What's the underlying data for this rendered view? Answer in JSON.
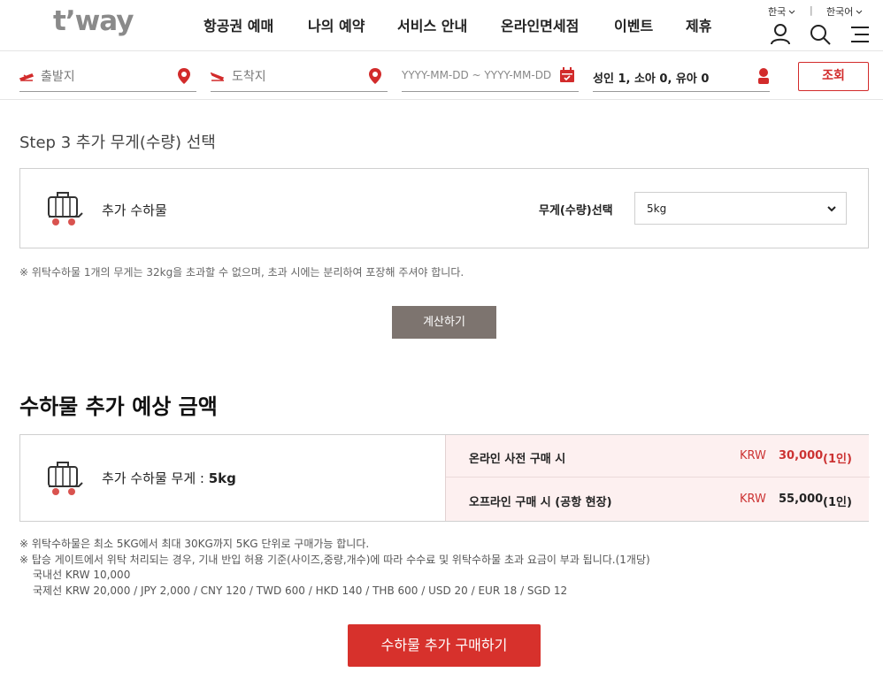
{
  "header": {
    "logo": "t’way",
    "nav": [
      "항공권 예매",
      "나의 예약",
      "서비스 안내",
      "온라인면세점",
      "이벤트",
      "제휴"
    ],
    "country": "한국",
    "separator": "|",
    "language": "한국어"
  },
  "search": {
    "departure_placeholder": "출발지",
    "arrival_placeholder": "도착지",
    "date_placeholder": "YYYY-MM-DD  ~ YYYY-MM-DD",
    "passengers": "성인 1, 소아 0, 유아 0",
    "submit_label": "조회"
  },
  "step": {
    "title": "Step 3 추가 무게(수량) 선택",
    "item_label": "추가 수하물",
    "select_label": "무게(수량)선택",
    "select_value": "5kg",
    "note": "※ 위탁수하물 1개의 무게는 32kg을 초과할 수 없으며, 초과 시에는 분리하여 포장해 주셔야 합니다.",
    "calc_button": "계산하기"
  },
  "estimate": {
    "title": "수하물 추가 예상 금액",
    "weight_label": "추가 수하물 무게 : ",
    "weight_value": "5kg",
    "rows": [
      {
        "label": "온라인 사전 구매 시",
        "currency": "KRW",
        "amount": "30,000",
        "per": "(1인)"
      },
      {
        "label": "오프라인 구매 시 (공항 현장)",
        "currency": "KRW",
        "amount": "55,000",
        "per": "(1인)"
      }
    ],
    "notes": [
      "※ 위탁수하물은 최소 5KG에서 최대 30KG까지 5KG 단위로 구매가능 합니다.",
      "※ 탑승 게이트에서 위탁 처리되는 경우, 기내 반입 허용 기준(사이즈,중량,개수)에 따라 수수료 및 위탁수하물 초과 요금이 부과 됩니다.(1개당)",
      "국내선 KRW 10,000",
      "국제선 KRW 20,000 / JPY 2,000 / CNY 120 / TWD 600 / HKD 140 / THB 600 / USD 20 / EUR 18 / SGD 12"
    ],
    "buy_button": "수하물 추가 구매하기"
  },
  "colors": {
    "brand_red": "#d7312c",
    "calc_button": "#7d746f",
    "price_bg": "#fdf0f0"
  }
}
